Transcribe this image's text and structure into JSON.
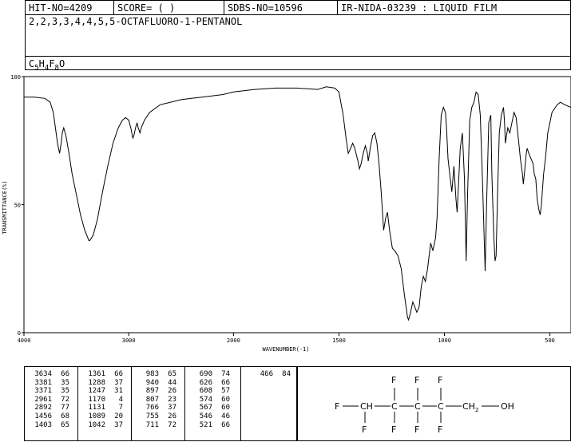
{
  "header": {
    "hit_no": "HIT-NO=4209",
    "score": "SCORE=  (   )",
    "sdbs_no": "SDBS-NO=10596",
    "ir_id": "IR-NIDA-03239 : LIQUID FILM"
  },
  "compound": {
    "name": "2,2,3,3,4,4,5,5-OCTAFLUORO-1-PENTANOL",
    "formula": {
      "c": "C",
      "c_n": "5",
      "h": "H",
      "h_n": "4",
      "f": "F",
      "f_n": "8",
      "o": "O"
    }
  },
  "chart_data": {
    "type": "line",
    "ylabel": "TRANSMITTANCE(%)",
    "xlabel": "WAVENUMBER(-1)",
    "x_ticks": [
      4000,
      3000,
      2000,
      1500,
      1000,
      500
    ],
    "x_tick_labels": [
      "4000",
      "3000",
      "2000",
      "1500",
      "1000",
      "500"
    ],
    "y_ticks": [
      0,
      50,
      100
    ],
    "y_tick_labels": [
      "0",
      "50",
      "100"
    ],
    "xlim": [
      4000,
      400
    ],
    "ylim": [
      0,
      100
    ],
    "x_axis_break": 2000,
    "series": [
      {
        "points": [
          [
            4000,
            92
          ],
          [
            3900,
            92
          ],
          [
            3800,
            91.5
          ],
          [
            3750,
            90
          ],
          [
            3720,
            86
          ],
          [
            3700,
            80
          ],
          [
            3680,
            74
          ],
          [
            3660,
            70
          ],
          [
            3645,
            74
          ],
          [
            3634,
            78
          ],
          [
            3620,
            80
          ],
          [
            3600,
            77
          ],
          [
            3570,
            70
          ],
          [
            3540,
            62
          ],
          [
            3500,
            54
          ],
          [
            3460,
            46
          ],
          [
            3420,
            40
          ],
          [
            3390,
            37
          ],
          [
            3381,
            36
          ],
          [
            3371,
            36
          ],
          [
            3340,
            38
          ],
          [
            3300,
            44
          ],
          [
            3250,
            55
          ],
          [
            3200,
            65
          ],
          [
            3150,
            74
          ],
          [
            3100,
            80
          ],
          [
            3060,
            83
          ],
          [
            3030,
            84
          ],
          [
            3000,
            83
          ],
          [
            2980,
            80
          ],
          [
            2961,
            76
          ],
          [
            2950,
            77
          ],
          [
            2935,
            80
          ],
          [
            2920,
            82
          ],
          [
            2910,
            80
          ],
          [
            2892,
            78
          ],
          [
            2880,
            80
          ],
          [
            2850,
            83
          ],
          [
            2800,
            86
          ],
          [
            2700,
            89
          ],
          [
            2600,
            90
          ],
          [
            2500,
            91
          ],
          [
            2400,
            91.5
          ],
          [
            2300,
            92
          ],
          [
            2100,
            93
          ],
          [
            2000,
            94
          ],
          [
            1900,
            95
          ],
          [
            1800,
            95.5
          ],
          [
            1700,
            95.5
          ],
          [
            1600,
            95
          ],
          [
            1560,
            96
          ],
          [
            1520,
            95.5
          ],
          [
            1500,
            94
          ],
          [
            1480,
            85
          ],
          [
            1465,
            75
          ],
          [
            1456,
            70
          ],
          [
            1445,
            72
          ],
          [
            1435,
            74
          ],
          [
            1425,
            72
          ],
          [
            1410,
            67
          ],
          [
            1403,
            64
          ],
          [
            1395,
            66
          ],
          [
            1385,
            70
          ],
          [
            1375,
            73
          ],
          [
            1365,
            70
          ],
          [
            1361,
            67
          ],
          [
            1350,
            73
          ],
          [
            1340,
            77
          ],
          [
            1330,
            78
          ],
          [
            1320,
            74
          ],
          [
            1310,
            66
          ],
          [
            1300,
            55
          ],
          [
            1288,
            40
          ],
          [
            1278,
            45
          ],
          [
            1270,
            47
          ],
          [
            1260,
            40
          ],
          [
            1247,
            33
          ],
          [
            1235,
            32
          ],
          [
            1220,
            30
          ],
          [
            1205,
            25
          ],
          [
            1190,
            15
          ],
          [
            1175,
            6
          ],
          [
            1170,
            5
          ],
          [
            1160,
            8
          ],
          [
            1150,
            12
          ],
          [
            1140,
            10
          ],
          [
            1131,
            8
          ],
          [
            1120,
            10
          ],
          [
            1110,
            18
          ],
          [
            1100,
            22
          ],
          [
            1090,
            20
          ],
          [
            1080,
            25
          ],
          [
            1065,
            35
          ],
          [
            1055,
            32
          ],
          [
            1042,
            37
          ],
          [
            1035,
            45
          ],
          [
            1025,
            68
          ],
          [
            1015,
            85
          ],
          [
            1005,
            88
          ],
          [
            995,
            86
          ],
          [
            990,
            80
          ],
          [
            983,
            68
          ],
          [
            975,
            62
          ],
          [
            965,
            55
          ],
          [
            955,
            65
          ],
          [
            945,
            52
          ],
          [
            940,
            47
          ],
          [
            935,
            55
          ],
          [
            925,
            72
          ],
          [
            915,
            78
          ],
          [
            905,
            60
          ],
          [
            897,
            28
          ],
          [
            890,
            55
          ],
          [
            880,
            83
          ],
          [
            870,
            88
          ],
          [
            860,
            90
          ],
          [
            850,
            94
          ],
          [
            840,
            93
          ],
          [
            830,
            85
          ],
          [
            820,
            60
          ],
          [
            807,
            24
          ],
          [
            800,
            50
          ],
          [
            790,
            82
          ],
          [
            780,
            85
          ],
          [
            775,
            62
          ],
          [
            766,
            38
          ],
          [
            760,
            28
          ],
          [
            755,
            30
          ],
          [
            748,
            55
          ],
          [
            740,
            78
          ],
          [
            730,
            85
          ],
          [
            720,
            88
          ],
          [
            715,
            82
          ],
          [
            711,
            74
          ],
          [
            700,
            80
          ],
          [
            690,
            78
          ],
          [
            680,
            82
          ],
          [
            670,
            86
          ],
          [
            660,
            84
          ],
          [
            650,
            76
          ],
          [
            640,
            68
          ],
          [
            630,
            62
          ],
          [
            626,
            58
          ],
          [
            620,
            63
          ],
          [
            612,
            70
          ],
          [
            608,
            72
          ],
          [
            600,
            70
          ],
          [
            590,
            68
          ],
          [
            580,
            66
          ],
          [
            574,
            62
          ],
          [
            567,
            60
          ],
          [
            560,
            52
          ],
          [
            552,
            48
          ],
          [
            546,
            46
          ],
          [
            540,
            50
          ],
          [
            535,
            56
          ],
          [
            530,
            62
          ],
          [
            521,
            68
          ],
          [
            510,
            78
          ],
          [
            490,
            86
          ],
          [
            466,
            89
          ],
          [
            450,
            90
          ],
          [
            430,
            89
          ],
          [
            400,
            88
          ]
        ]
      }
    ]
  },
  "peaks": {
    "columns": [
      [
        [
          "3634",
          "66"
        ],
        [
          "3381",
          "35"
        ],
        [
          "3371",
          "35"
        ],
        [
          "2961",
          "72"
        ],
        [
          "2892",
          "77"
        ],
        [
          "1456",
          "68"
        ],
        [
          "1403",
          "65"
        ]
      ],
      [
        [
          "1361",
          "66"
        ],
        [
          "1288",
          "37"
        ],
        [
          "1247",
          "31"
        ],
        [
          "1170",
          "4"
        ],
        [
          "1131",
          "7"
        ],
        [
          "1089",
          "20"
        ],
        [
          "1042",
          "37"
        ]
      ],
      [
        [
          "983",
          "65"
        ],
        [
          "940",
          "44"
        ],
        [
          "897",
          "26"
        ],
        [
          "807",
          "23"
        ],
        [
          "766",
          "37"
        ],
        [
          "755",
          "26"
        ],
        [
          "711",
          "72"
        ]
      ],
      [
        [
          "690",
          "74"
        ],
        [
          "626",
          "66"
        ],
        [
          "608",
          "57"
        ],
        [
          "574",
          "60"
        ],
        [
          "567",
          "60"
        ],
        [
          "546",
          "46"
        ],
        [
          "521",
          "66"
        ]
      ],
      [
        [
          "466",
          "84"
        ]
      ]
    ]
  },
  "structure": {
    "atoms": [
      "F",
      "F",
      "F",
      "F",
      "F",
      "F",
      "F",
      "F",
      "F",
      "CH",
      "C",
      "C",
      "C",
      "CH",
      "2",
      "OH"
    ]
  }
}
